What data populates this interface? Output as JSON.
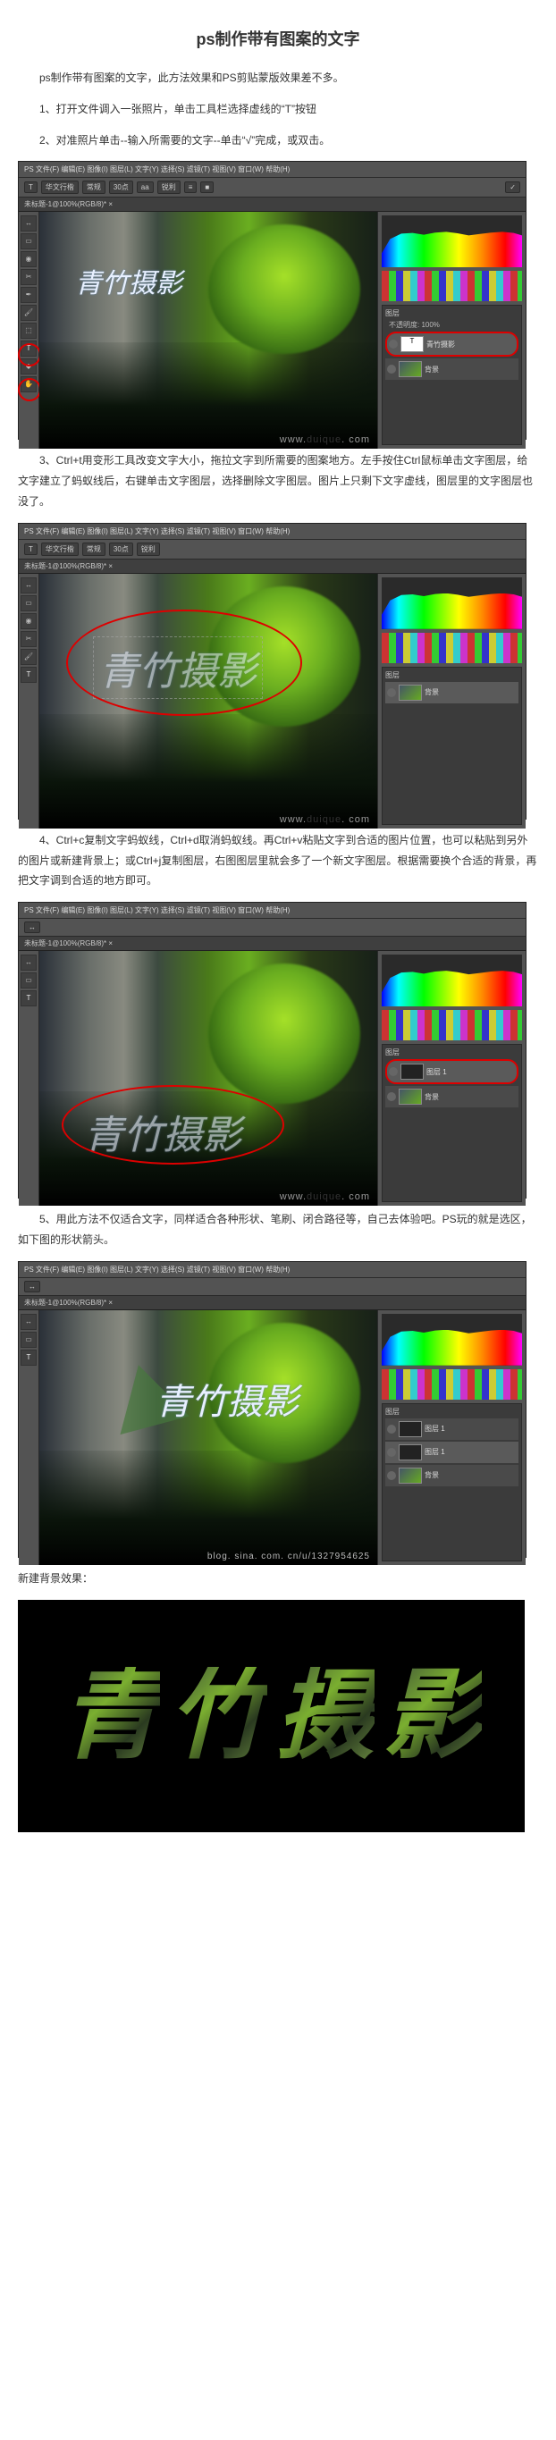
{
  "title": "ps制作带有图案的文字",
  "intro": "ps制作带有图案的文字，此方法效果和PS剪贴蒙版效果差不多。",
  "steps": {
    "s1": "1、打开文件调入一张照片，单击工具栏选择虚线的“T”按钮",
    "s2": "2、对准照片单击--输入所需要的文字--单击“√”完成，或双击。",
    "s3": "3、Ctrl+t用变形工具改变文字大小，拖拉文字到所需要的图案地方。左手按住Ctrl鼠标单击文字图层，给文字建立了蚂蚁线后，右键单击文字图层，选择删除文字图层。图片上只剩下文字虚线，图层里的文字图层也没了。",
    "s4": "4、Ctrl+c复制文字蚂蚁线，Ctrl+d取消蚂蚁线。再Ctrl+v粘贴文字到合适的图片位置，也可以粘贴到另外的图片或新建背景上；或Ctrl+j复制图层，右图图层里就会多了一个新文字图层。根据需要换个合适的背景，再把文字调到合适的地方即可。",
    "s5": "5、用此方法不仅适合文字，同样适合各种形状、笔刷、闭合路径等，自己去体验吧。PS玩的就是选区，如下图的形状箭头。",
    "new_bg": "新建背景效果："
  },
  "ps": {
    "menubar": "PS  文件(F)  编辑(E)  图像(I)  图层(L)  文字(Y)  选择(S)  滤镜(T)  视图(V)  窗口(W)  帮助(H)",
    "tab": "未标题-1@100%(RGB/8)*  ×",
    "opt_t": "T",
    "opt_font_label": "华文行楷",
    "opt_style": "常规",
    "opt_size": "30点",
    "opt_aa": "aa",
    "opt_sharp": "锐利",
    "opt_align": "≡",
    "opt_color": "■",
    "opt_commit": "✓",
    "text_overlay": "青竹摄影",
    "wm_prefix": "www.",
    "wm_mid": "duique",
    "wm_suffix": ". com",
    "blog_wm": "blog. sina. com. cn/u/1327954625",
    "layers_hdr": "图层",
    "opacity_label": "不透明度: 100%",
    "layer_text": "青竹摄影",
    "layer_bg": "背景",
    "layer_1": "图层 1",
    "tool_T": "T"
  },
  "final_text": [
    "青",
    "竹",
    "摄",
    "影"
  ]
}
